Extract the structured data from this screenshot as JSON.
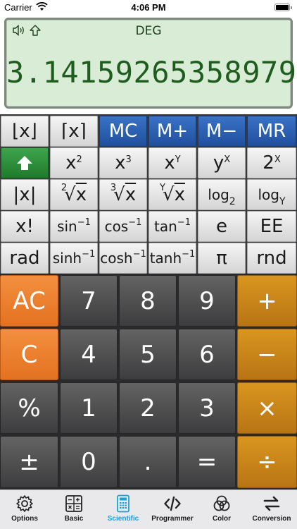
{
  "status_bar": {
    "carrier": "Carrier",
    "time": "4:06 PM"
  },
  "display": {
    "mode": "DEG",
    "value": "3.14159265358979",
    "icons": [
      "speaker-icon",
      "shift-arrow-icon"
    ]
  },
  "sci_keys": {
    "floor": "⌊x⌋",
    "ceil": "⌈x⌉",
    "mc": "MC",
    "mplus": "M+",
    "mminus": "M−",
    "mr": "MR",
    "x": "x",
    "y": "y",
    "two": "2",
    "sq_exp": "2",
    "cube_exp": "3",
    "Y": "Y",
    "X": "X",
    "abs": "|x|",
    "root2_idx": "2",
    "root3_idx": "3",
    "rooty_idx": "Y",
    "log": "log",
    "log2_base": "2",
    "logy_base": "Y",
    "fact": "x!",
    "sin": "sin",
    "cos": "cos",
    "tan": "tan",
    "inv": "−1",
    "e": "e",
    "ee": "EE",
    "rad": "rad",
    "sinh": "sinh",
    "cosh": "cosh",
    "tanh": "tanh",
    "pi": "π",
    "rnd": "rnd"
  },
  "pad_keys": {
    "ac": "AC",
    "c": "C",
    "percent": "%",
    "plusminus": "±",
    "d7": "7",
    "d8": "8",
    "d9": "9",
    "d4": "4",
    "d5": "5",
    "d6": "6",
    "d1": "1",
    "d2": "2",
    "d3": "3",
    "d0": "0",
    "dot": ".",
    "equals": "=",
    "add": "+",
    "sub": "−",
    "mul": "×",
    "div": "÷"
  },
  "tabs": [
    {
      "label": "Options",
      "icon": "gear-icon"
    },
    {
      "label": "Basic",
      "icon": "calculator-icon"
    },
    {
      "label": "Scientific",
      "icon": "scientific-calculator-icon",
      "active": true
    },
    {
      "label": "Programmer",
      "icon": "code-icon"
    },
    {
      "label": "Color",
      "icon": "color-circles-icon"
    },
    {
      "label": "Conversion",
      "icon": "swap-arrows-icon"
    }
  ],
  "colors": {
    "accent": "#1aa0d8",
    "memory": "#2b5fb0",
    "shift": "#2e8f3b",
    "orange": "#ec7f2e",
    "operator": "#c8851a",
    "lcd": "#d8ecd6"
  }
}
